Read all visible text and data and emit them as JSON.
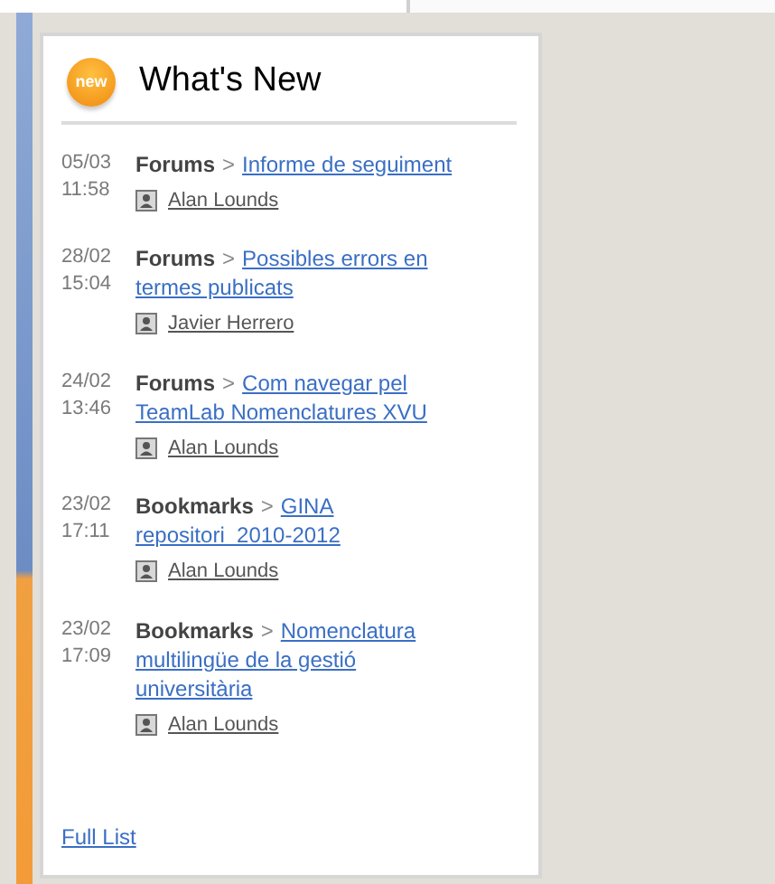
{
  "widget": {
    "badge": "new",
    "title": "What's New"
  },
  "entries": [
    {
      "date": "05/03",
      "time": "11:58",
      "module": "Forums",
      "separator": ">",
      "link_lines": [
        "Informe de seguiment"
      ],
      "author": "Alan Lounds"
    },
    {
      "date": "28/02",
      "time": "15:04",
      "module": "Forums",
      "separator": ">",
      "link_lines": [
        "Possibles errors en",
        "termes publicats"
      ],
      "author": "Javier Herrero"
    },
    {
      "date": "24/02",
      "time": "13:46",
      "module": "Forums",
      "separator": ">",
      "link_lines": [
        "Com navegar pel",
        "TeamLab Nomenclatures XVU"
      ],
      "author": "Alan Lounds"
    },
    {
      "date": "23/02",
      "time": "17:11",
      "module": "Bookmarks",
      "separator": ">",
      "link_lines": [
        "GINA",
        "repositori  2010-2012"
      ],
      "author": "Alan Lounds"
    },
    {
      "date": "23/02",
      "time": "17:09",
      "module": "Bookmarks",
      "separator": ">",
      "link_lines": [
        "Nomenclatura",
        "multilingüe de la gestió",
        "universitària"
      ],
      "author": "Alan Lounds"
    }
  ],
  "footer_link": "Full List"
}
